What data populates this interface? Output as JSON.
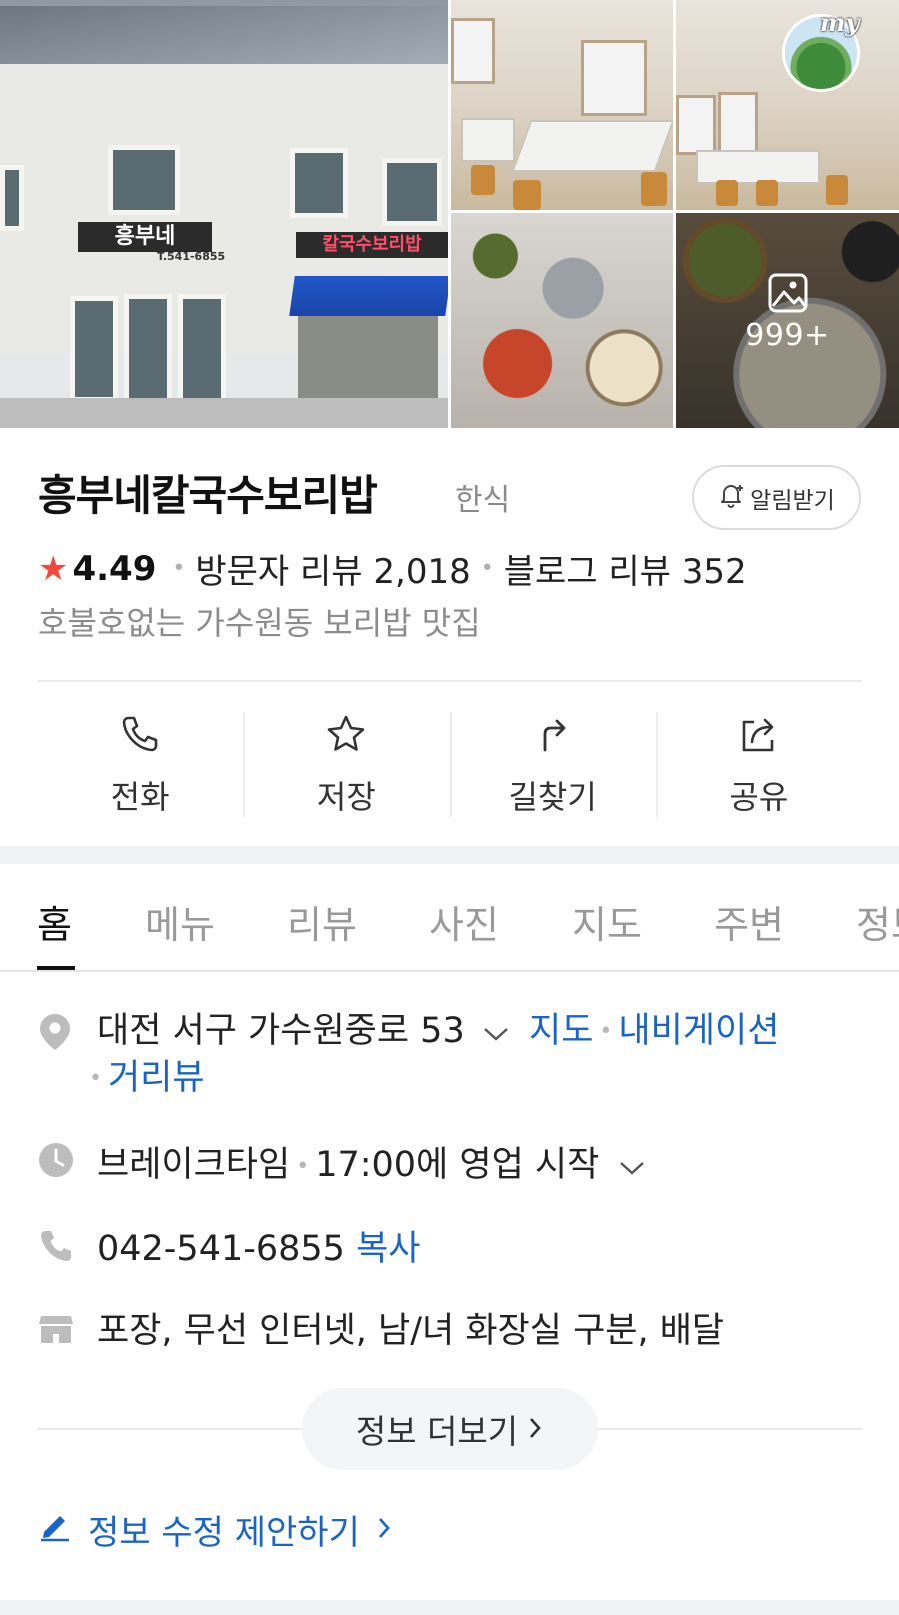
{
  "gallery": {
    "photo_count": "999+",
    "my_badge": "my",
    "storefront_sign": "흥부네",
    "storefront_phone": "T.541-6855",
    "storefront_sign2": "칼국수보리밥"
  },
  "place": {
    "name": "흥부네칼국수보리밥",
    "category": "한식",
    "alarm_label": "알림받기",
    "rating": "4.49",
    "visitor_reviews": "방문자 리뷰 2,018",
    "blog_reviews": "블로그 리뷰 352",
    "tagline": "호불호없는 가수원동 보리밥 맛집"
  },
  "actions": [
    {
      "label": "전화",
      "icon": "phone-icon"
    },
    {
      "label": "저장",
      "icon": "star-icon"
    },
    {
      "label": "길찾기",
      "icon": "directions-icon"
    },
    {
      "label": "공유",
      "icon": "share-icon"
    }
  ],
  "tabs": [
    {
      "label": "홈",
      "active": true
    },
    {
      "label": "메뉴"
    },
    {
      "label": "리뷰"
    },
    {
      "label": "사진"
    },
    {
      "label": "지도"
    },
    {
      "label": "주변"
    },
    {
      "label": "정보"
    }
  ],
  "info": {
    "address": "대전 서구 가수원중로 53",
    "address_links": {
      "map": "지도",
      "navigation": "내비게이션",
      "streetview": "거리뷰"
    },
    "hours_status": "브레이크타임",
    "hours_detail": "17:00에 영업 시작",
    "phone": "042-541-6855",
    "copy_label": "복사",
    "amenities": "포장, 무선 인터넷, 남/녀 화장실 구분, 배달"
  },
  "more_info_label": "정보 더보기",
  "suggest_edit_label": "정보 수정 제안하기",
  "colors": {
    "accent_link": "#1a64c8",
    "star": "#f0493e",
    "muted_text": "#8c8c8c"
  }
}
